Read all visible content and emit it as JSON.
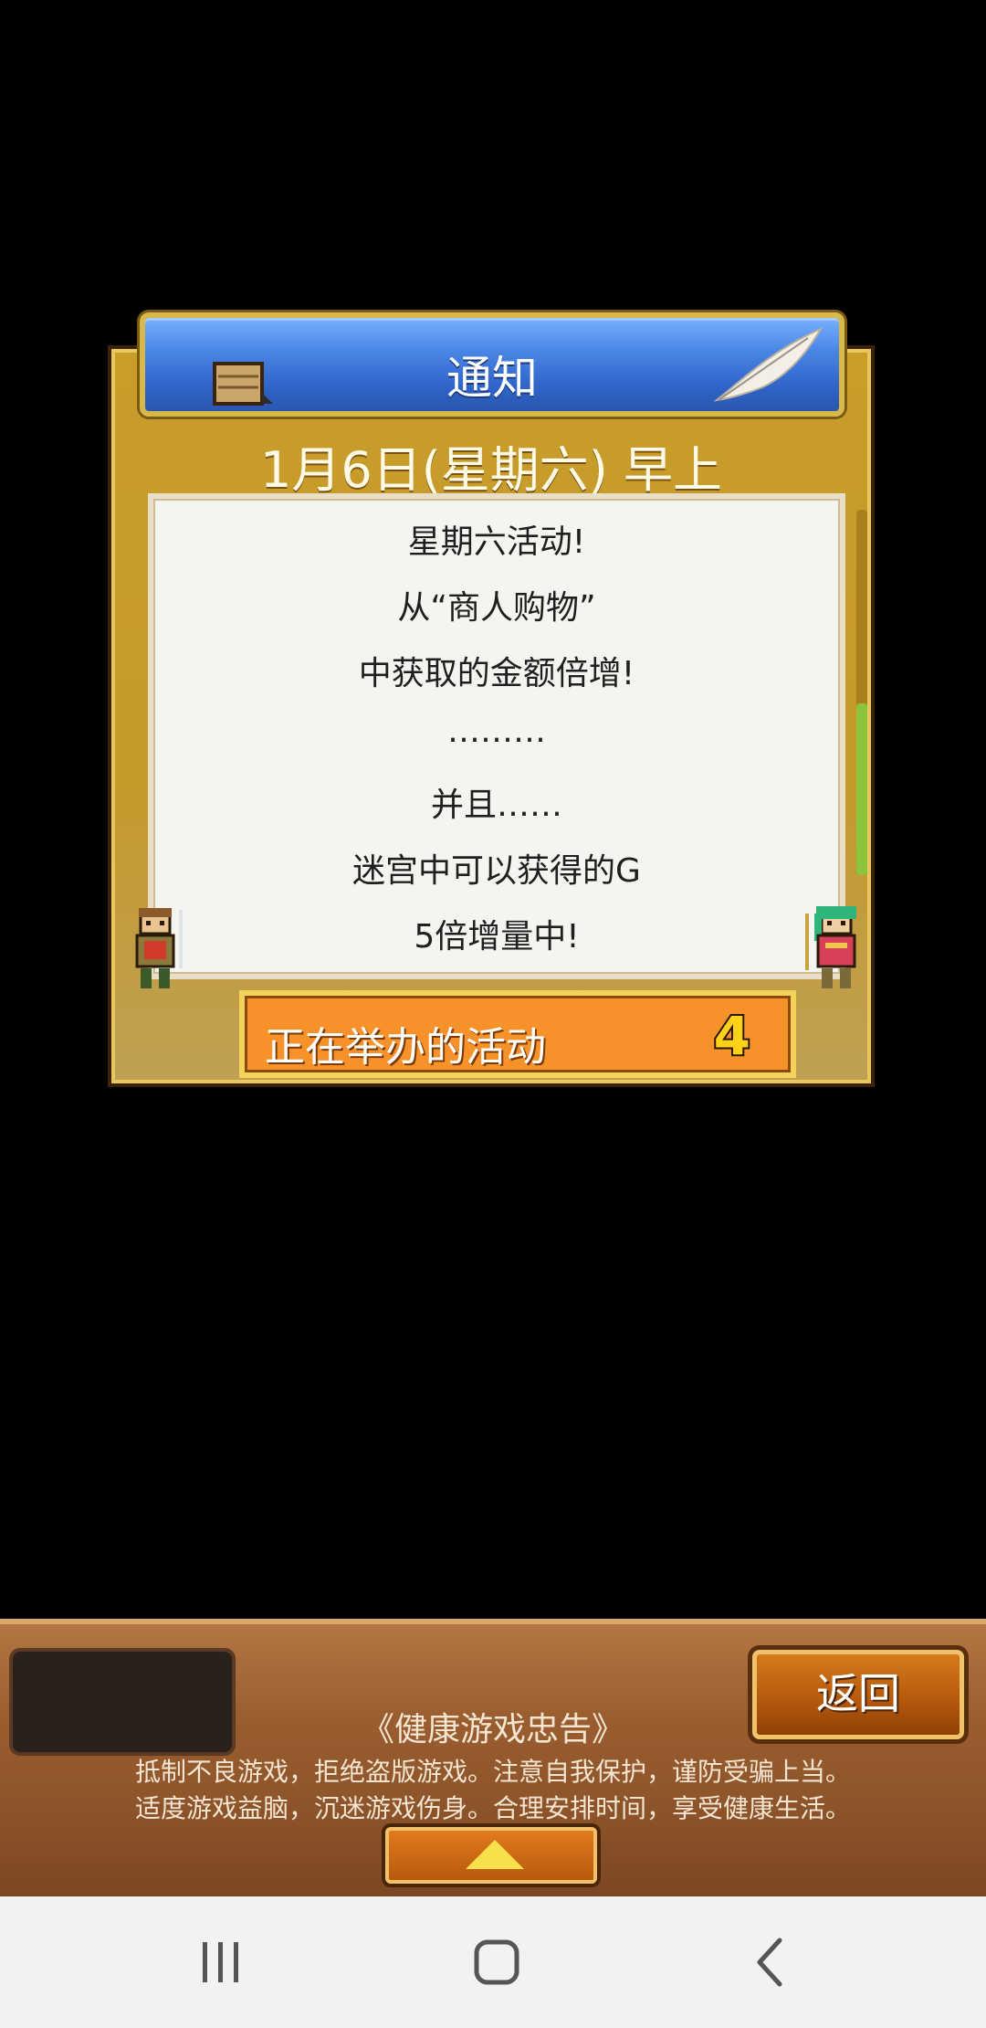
{
  "dialog": {
    "title": "通知",
    "date": "1月6日(星期六) 早上",
    "message_lines": [
      "星期六活动!",
      "从“商人购物”",
      "中获取的金额倍增!",
      "………",
      "并且……",
      "迷宫中可以获得的G",
      "5倍增量中!"
    ],
    "event_bar": {
      "label": "正在举办的活动",
      "count": "4"
    },
    "icons": {
      "header_left": "crate-icon",
      "header_right": "quill-icon",
      "left_character": "adventurer-sprite",
      "right_character": "adventurer-sprite"
    }
  },
  "bottom_panel": {
    "back_button": "返回",
    "health_title": "《健康游戏忠告》",
    "health_lines": [
      "抵制不良游戏，拒绝盗版游戏。注意自我保护，谨防受骗上当。",
      "适度游戏益脑，沉迷游戏伤身。合理安排时间，享受健康生活。"
    ],
    "expand_icon": "triangle-up-icon"
  },
  "nav_bar": {
    "buttons": [
      "recent-apps-icon",
      "home-icon",
      "back-icon"
    ]
  }
}
